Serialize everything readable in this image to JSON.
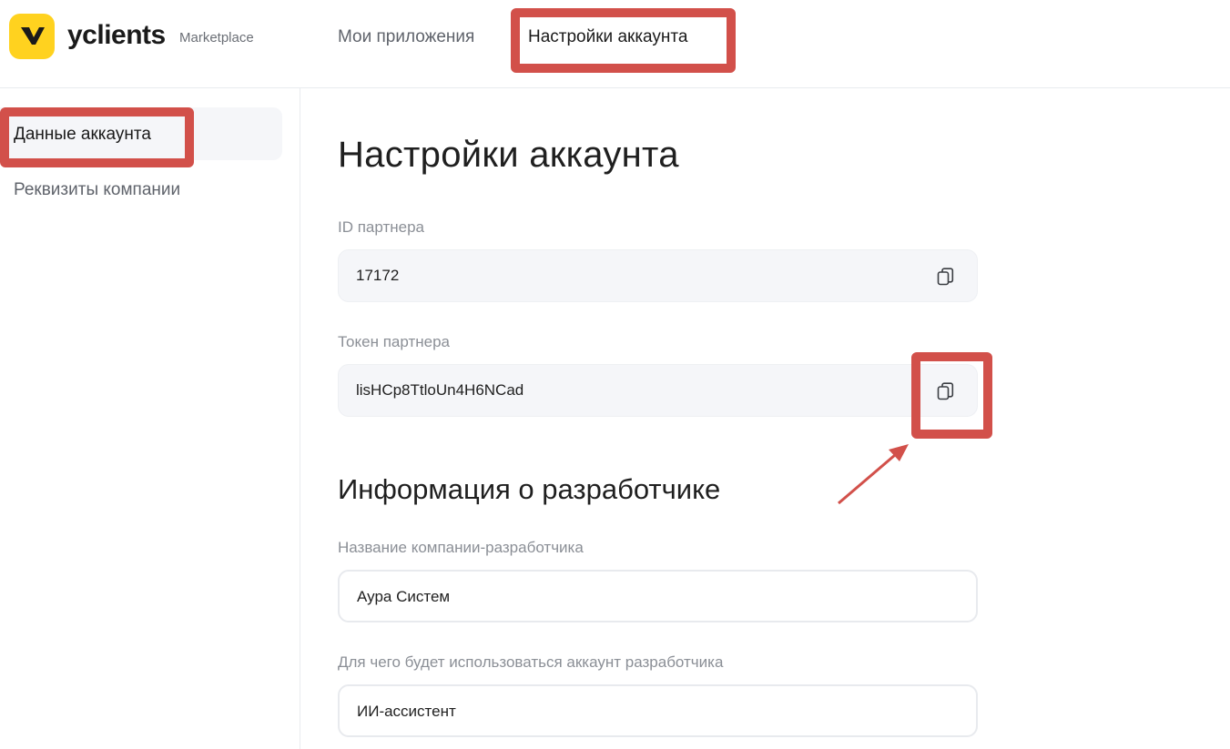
{
  "header": {
    "brand_name": "yclients",
    "brand_sub": "Marketplace",
    "nav": {
      "apps_label": "Мои приложения",
      "settings_label": "Настройки аккаунта"
    }
  },
  "sidebar": {
    "items": [
      {
        "label": "Данные аккаунта",
        "active": true
      },
      {
        "label": "Реквизиты компании",
        "active": false
      }
    ]
  },
  "main": {
    "title": "Настройки аккаунта",
    "partner_id": {
      "label": "ID партнера",
      "value": "17172"
    },
    "partner_token": {
      "label": "Токен партнера",
      "value": "lisHCp8TtloUn4H6NCad"
    },
    "developer_section_title": "Информация о разработчике",
    "company_name": {
      "label": "Название компании-разработчика",
      "value": "Аура Систем"
    },
    "account_purpose": {
      "label": "Для чего будет использоваться аккаунт разработчика",
      "value": "ИИ-ассистент"
    }
  },
  "icons": {
    "logo": "yclients-logo-icon",
    "copy": "copy-icon"
  },
  "colors": {
    "brand_yellow": "#ffd21f",
    "annotation_red": "#d2504a",
    "field_bg": "#f5f6f9"
  }
}
